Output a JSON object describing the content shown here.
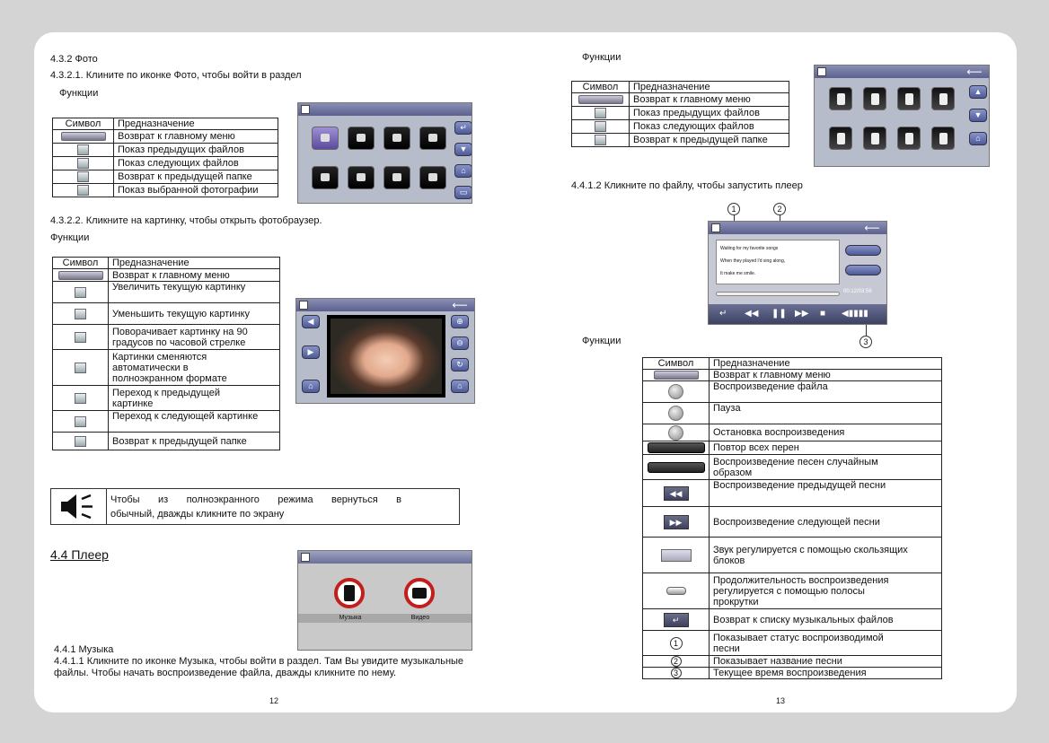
{
  "left_page": {
    "section_432": "4.3.2 Фото",
    "section_4321": "4.3.2.1. Клините по иконке Фото, чтобы войти в раздел",
    "functions_label_1": "Функции",
    "table_photo": {
      "headers": [
        "Символ",
        "Предназначение"
      ],
      "rows": [
        "Возврат к главному меню",
        "Показ предыдущих файлов",
        "Показ следующих файлов",
        "Возврат к предыдущей папке",
        "Показ выбранной фотографии"
      ]
    },
    "section_4322": "4.3.2.2. Кликните на картинку, чтобы открыть фотобраузер.",
    "functions_label_2": "Функции",
    "table_browser": {
      "headers": [
        "Символ",
        "Предназначение"
      ],
      "rows": [
        {
          "lines": [
            "Возврат к главному меню"
          ]
        },
        {
          "lines": [
            "Увеличить текущую картинку"
          ]
        },
        {
          "lines": [
            "Уменьшить текущую картинку"
          ]
        },
        {
          "lines": [
            "Поворачивает картинку на 90",
            "градусов по часовой стрелке"
          ]
        },
        {
          "lines": [
            "Картинки сменяются",
            "автоматически в",
            "полноэкранном формате"
          ]
        },
        {
          "lines": [
            "Переход к предыдущей",
            "картинке"
          ]
        },
        {
          "lines": [
            "Переход к следующей картинке"
          ]
        },
        {
          "lines": [
            "Возврат к предыдущей папке"
          ]
        }
      ]
    },
    "note_line1_words": [
      "Чтобы",
      "из",
      "полноэкранного",
      "режима",
      "вернуться",
      "в"
    ],
    "note_line2": "обычный, дважды кликните по экрану",
    "section_44": "4.4 Плеер",
    "section_441": "4.4.1 Музыка",
    "section_4411_line1": "4.4.1.1 Кликните по иконке Музыка, чтобы войти в раздел. Там Вы увидите музыкальные",
    "section_4411_line2": "файлы. Чтобы начать воспроизведение файла, дважды кликните по  нему.",
    "page_number": "12",
    "player_menu": {
      "music": "Музыка",
      "video": "Видео"
    }
  },
  "right_page": {
    "functions_label_1": "Функции",
    "table_music_files": {
      "headers": [
        "Символ",
        "Предназначение"
      ],
      "rows": [
        "Возврат к главному меню",
        "Показ предыдущих файлов",
        "Показ следующих файлов",
        "Возврат к предыдущей папке"
      ]
    },
    "section_4412": "4.4.1.2 Кликните по файлу, чтобы запустить плеер",
    "callouts": [
      "1",
      "2",
      "3"
    ],
    "functions_label_2": "Функции",
    "table_player": {
      "headers": [
        "Символ",
        "Предназначение"
      ],
      "rows": [
        {
          "lines": [
            "Возврат к главному меню"
          ]
        },
        {
          "lines": [
            "Воспроизведение файла"
          ]
        },
        {
          "lines": [
            "Пауза"
          ]
        },
        {
          "lines": [
            "Остановка воспроизведения"
          ]
        },
        {
          "lines": [
            "Повтор всех перен"
          ]
        },
        {
          "lines": [
            "Воспроизведение песен случайным",
            "образом"
          ]
        },
        {
          "lines": [
            "Воспроизведение предыдущей песни"
          ]
        },
        {
          "lines": [
            "Воспроизведение следующей песни"
          ]
        },
        {
          "lines": [
            "Звук регулируется с помощью скользящих",
            "блоков"
          ]
        },
        {
          "lines": [
            "Продолжительность воспроизведения",
            "регулируется с помощью  полосы",
            "прокрутки"
          ]
        },
        {
          "lines": [
            "Возврат к списку музыкальных файлов"
          ]
        },
        {
          "lines": [
            "Показывает статус воспроизводимой",
            "песни"
          ]
        },
        {
          "lines": [
            "Показывает название песни"
          ]
        },
        {
          "lines": [
            "Текущее время воспроизведения"
          ]
        }
      ]
    },
    "lyrics": [
      "Waiting for my favorite songs",
      "When they played I'd sing along,",
      "It make me smile."
    ],
    "player_time": "00:12/03:56",
    "page_number": "13"
  }
}
